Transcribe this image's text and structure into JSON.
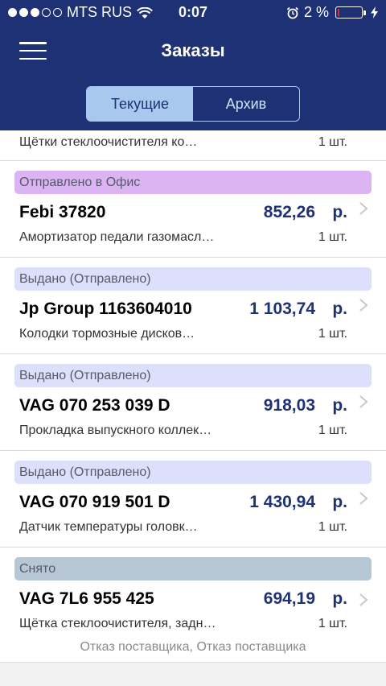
{
  "status_bar": {
    "carrier": "MTS RUS",
    "time": "0:07",
    "battery": "2 %"
  },
  "header": {
    "title": "Заказы",
    "tabs": [
      {
        "label": "Текущие",
        "active": true
      },
      {
        "label": "Архив",
        "active": false
      }
    ]
  },
  "partial_row": {
    "description": "Щётки стеклоочистителя ко…",
    "quantity": "1 шт."
  },
  "orders": [
    {
      "status": "Отправлено в Офис",
      "part": "Febi 37820",
      "price": "852,26",
      "currency": "р.",
      "description": "Амортизатор педали газомасл…",
      "quantity": "1 шт."
    },
    {
      "status": "Выдано (Отправлено)",
      "part": "Jp Group 1163604010",
      "price": "1 103,74",
      "currency": "р.",
      "description": "Колодки тормозные дисков…",
      "quantity": "1 шт."
    },
    {
      "status": "Выдано (Отправлено)",
      "part": "VAG 070 253 039 D",
      "price": "918,03",
      "currency": "р.",
      "description": "Прокладка выпускного коллек…",
      "quantity": "1 шт."
    },
    {
      "status": "Выдано (Отправлено)",
      "part": "VAG 070 919 501 D",
      "price": "1 430,94",
      "currency": "р.",
      "description": "Датчик температуры головк…",
      "quantity": "1 шт."
    },
    {
      "status": "Снято",
      "part": "VAG 7L6 955 425",
      "price": "694,19",
      "currency": "р.",
      "description": "Щётка стеклоочистителя, задн…",
      "quantity": "1 шт.",
      "reason": "Отказ поставщика, Отказ поставщика"
    }
  ],
  "colors": {
    "header_bg": "#1f3175",
    "status_office": "#dcb3f3",
    "status_issued": "#dde0fb",
    "status_removed": "#b7c7d3",
    "price": "#1f3175"
  }
}
